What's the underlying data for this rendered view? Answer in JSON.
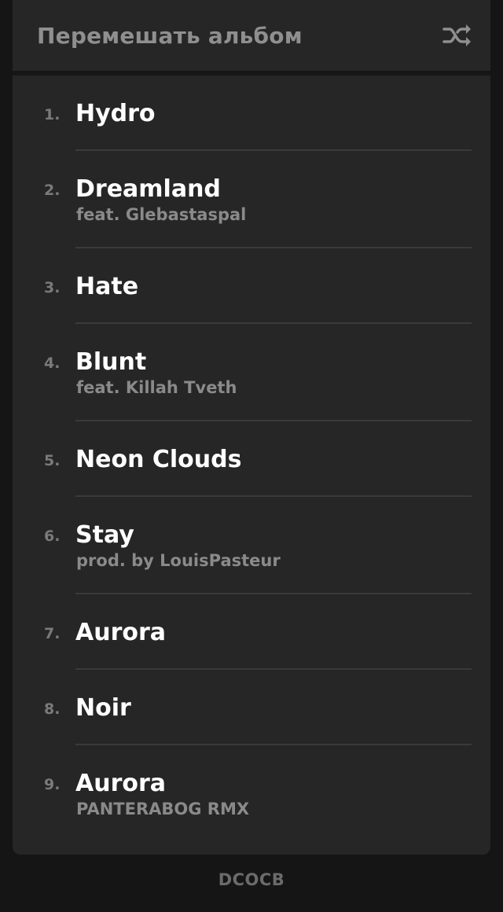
{
  "header": {
    "title": "Перемешать альбом",
    "shuffle_icon": "shuffle-icon"
  },
  "tracks": [
    {
      "number": "1.",
      "title": "Hydro",
      "subtitle": ""
    },
    {
      "number": "2.",
      "title": "Dreamland",
      "subtitle": "feat. Glebastaspal"
    },
    {
      "number": "3.",
      "title": "Hate",
      "subtitle": ""
    },
    {
      "number": "4.",
      "title": "Blunt",
      "subtitle": "feat. Killah Tveth"
    },
    {
      "number": "5.",
      "title": "Neon Clouds",
      "subtitle": ""
    },
    {
      "number": "6.",
      "title": "Stay",
      "subtitle": "prod. by LouisPasteur"
    },
    {
      "number": "7.",
      "title": "Aurora",
      "subtitle": ""
    },
    {
      "number": "8.",
      "title": "Noir",
      "subtitle": ""
    },
    {
      "number": "9.",
      "title": "Aurora",
      "subtitle": "PANTERABOG RMX"
    }
  ],
  "footer": {
    "label": "DCOCB"
  },
  "colors": {
    "background": "#151515",
    "panel": "#262626",
    "title_text": "#ffffff",
    "muted_text": "#8a8a8a",
    "separator": "#3a3a3a"
  }
}
